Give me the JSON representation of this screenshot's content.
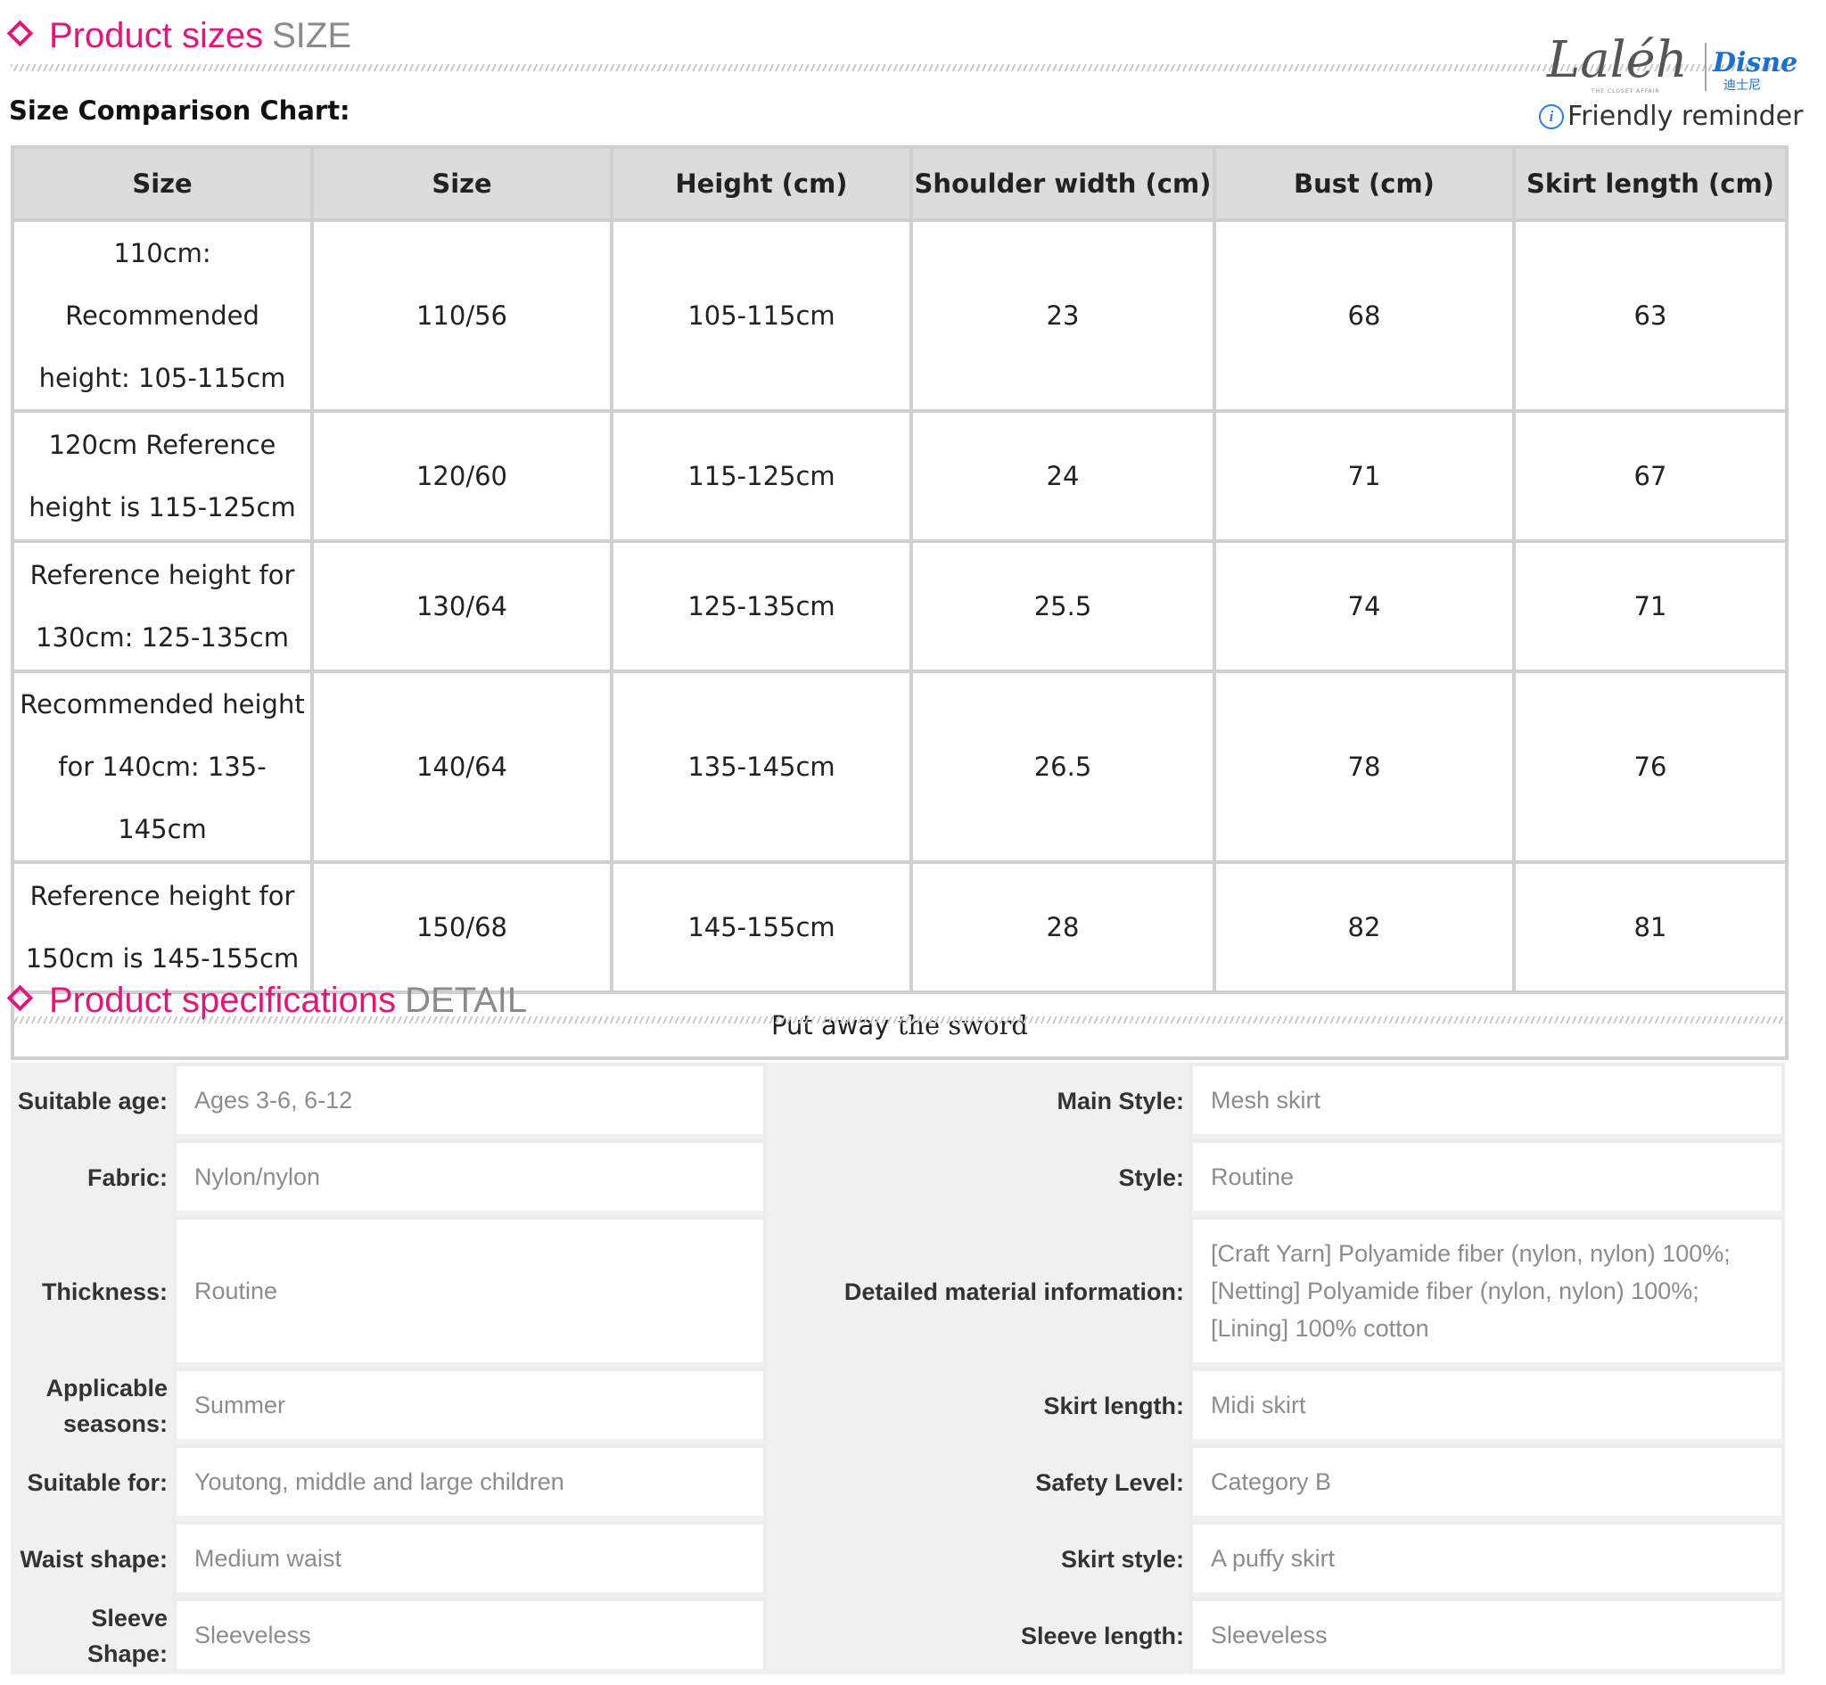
{
  "size_section": {
    "title": "Product sizes",
    "subtitle": "SIZE",
    "chart_label": "Size Comparison Chart:",
    "reminder": "Friendly reminder",
    "columns": [
      "Size",
      "Size",
      "Height (cm)",
      "Shoulder width (cm)",
      "Bust (cm)",
      "Skirt length (cm)"
    ],
    "rows": [
      [
        "110cm: Recommended height: 105-115cm",
        "110/56",
        "105-115cm",
        "23",
        "68",
        "63"
      ],
      [
        "120cm Reference height is 115-125cm",
        "120/60",
        "115-125cm",
        "24",
        "71",
        "67"
      ],
      [
        "Reference height for 130cm: 125-135cm",
        "130/64",
        "125-135cm",
        "25.5",
        "74",
        "71"
      ],
      [
        "Recommended height for 140cm: 135-145cm",
        "140/64",
        "135-145cm",
        "26.5",
        "78",
        "76"
      ],
      [
        "Reference height for 150cm is 145-155cm",
        "150/68",
        "145-155cm",
        "28",
        "82",
        "81"
      ]
    ],
    "footer": {
      "part1": "Put away",
      "part2": "the",
      "part3": "sword"
    }
  },
  "logo": {
    "script_text": "Laléh",
    "tagline": "THE CLOSET AFFAIR",
    "brand": "Disney",
    "brand_cn": "迪士尼",
    "brand_color": "#1d6fc9"
  },
  "spec_section": {
    "title": "Product specifications",
    "subtitle": "DETAIL",
    "rows": [
      {
        "l_label": "Suitable age:",
        "l_value": "Ages 3-6, 6-12",
        "r_label": "Main Style:",
        "r_value": "Mesh skirt"
      },
      {
        "l_label": "Fabric:",
        "l_value": "Nylon/nylon",
        "r_label": "Style:",
        "r_value": "Routine"
      },
      {
        "l_label": "Thickness:",
        "l_value": "Routine",
        "r_label": "Detailed material information:",
        "r_value_lines": [
          "[Craft Yarn] Polyamide fiber (nylon, nylon) 100%;",
          "[Netting] Polyamide fiber (nylon, nylon) 100%;",
          "[Lining] 100% cotton"
        ]
      },
      {
        "l_label": "Applicable seasons:",
        "l_value": "Summer",
        "r_label": "Skirt length:",
        "r_value": "Midi skirt"
      },
      {
        "l_label": "Suitable for:",
        "l_value": "Youtong, middle and large children",
        "r_label": "Safety Level:",
        "r_value": "Category B"
      },
      {
        "l_label": "Waist shape:",
        "l_value": "Medium waist",
        "r_label": "Skirt style:",
        "r_value": "A puffy skirt"
      },
      {
        "l_label": "Sleeve Shape:",
        "l_value": "Sleeveless",
        "r_label": "Sleeve length:",
        "r_value": "Sleeveless"
      }
    ]
  },
  "colors": {
    "accent": "#e0177a",
    "muted": "#8a8a8a",
    "header_bg": "#dcdcdc",
    "border": "#cfcfcf"
  }
}
